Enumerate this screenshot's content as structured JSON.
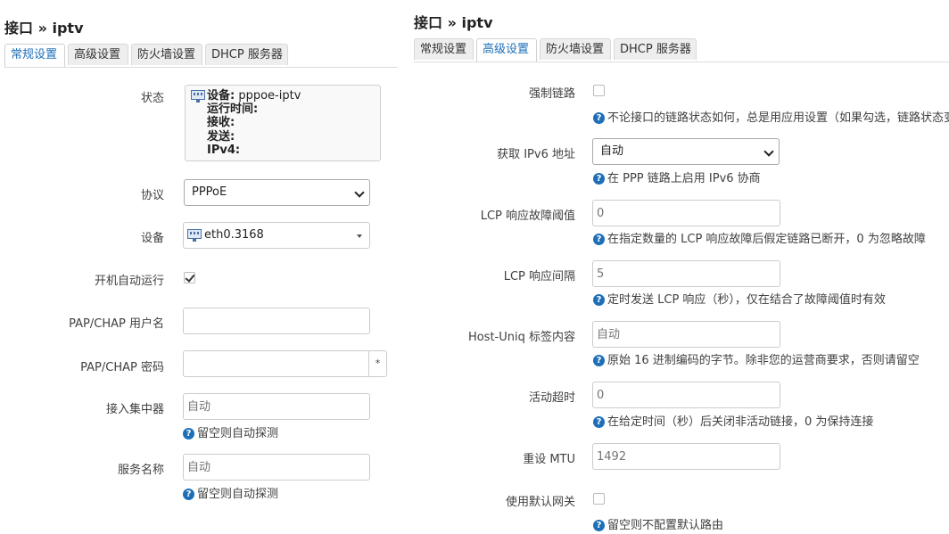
{
  "left": {
    "title": "接口 » iptv",
    "tabs": [
      "常规设置",
      "高级设置",
      "防火墙设置",
      "DHCP 服务器"
    ],
    "status": {
      "label": "状态",
      "device_label": "设备:",
      "device_value": "pppoe-iptv",
      "uptime_label": "运行时间:",
      "rx_label": "接收:",
      "tx_label": "发送:",
      "ipv4_label": "IPv4:"
    },
    "protocol": {
      "label": "协议",
      "value": "PPPoE"
    },
    "device": {
      "label": "设备",
      "value": "eth0.3168"
    },
    "autostart": {
      "label": "开机自动运行",
      "checked": true
    },
    "username": {
      "label": "PAP/CHAP 用户名",
      "value": ""
    },
    "password": {
      "label": "PAP/CHAP 密码",
      "value": "",
      "reveal": "*"
    },
    "ac": {
      "label": "接入集中器",
      "placeholder": "自动",
      "hint": "留空则自动探测"
    },
    "service": {
      "label": "服务名称",
      "placeholder": "自动",
      "hint": "留空则自动探测"
    }
  },
  "right": {
    "title": "接口 » iptv",
    "tabs": [
      "常规设置",
      "高级设置",
      "防火墙设置",
      "DHCP 服务器"
    ],
    "force_link": {
      "label": "强制链路",
      "checked": false,
      "hint": "不论接口的链路状态如何，总是用应用设置（如果勾选，链路状态变"
    },
    "ipv6": {
      "label": "获取 IPv6 地址",
      "value": "自动",
      "hint": "在 PPP 链路上启用 IPv6 协商"
    },
    "lcp_fail": {
      "label": "LCP 响应故障阈值",
      "placeholder": "0",
      "hint": "在指定数量的 LCP 响应故障后假定链路已断开，0 为忽略故障"
    },
    "lcp_interval": {
      "label": "LCP 响应间隔",
      "placeholder": "5",
      "hint": "定时发送 LCP 响应（秒），仅在结合了故障阈值时有效"
    },
    "host_uniq": {
      "label": "Host-Uniq 标签内容",
      "placeholder": "自动",
      "hint": "原始 16 进制编码的字节。除非您的运营商要求，否则请留空"
    },
    "idle": {
      "label": "活动超时",
      "placeholder": "0",
      "hint": "在给定时间（秒）后关闭非活动链接，0 为保持连接"
    },
    "mtu": {
      "label": "重设 MTU",
      "placeholder": "1492"
    },
    "default_gw": {
      "label": "使用默认网关",
      "checked": false,
      "hint": "留空则不配置默认路由"
    }
  },
  "colors": {
    "accent": "#1e6fb8",
    "tab_bg": "#eeeeee",
    "border": "#cccccc"
  },
  "icons": {
    "help": "question-circle-icon",
    "network": "network-port-icon"
  }
}
